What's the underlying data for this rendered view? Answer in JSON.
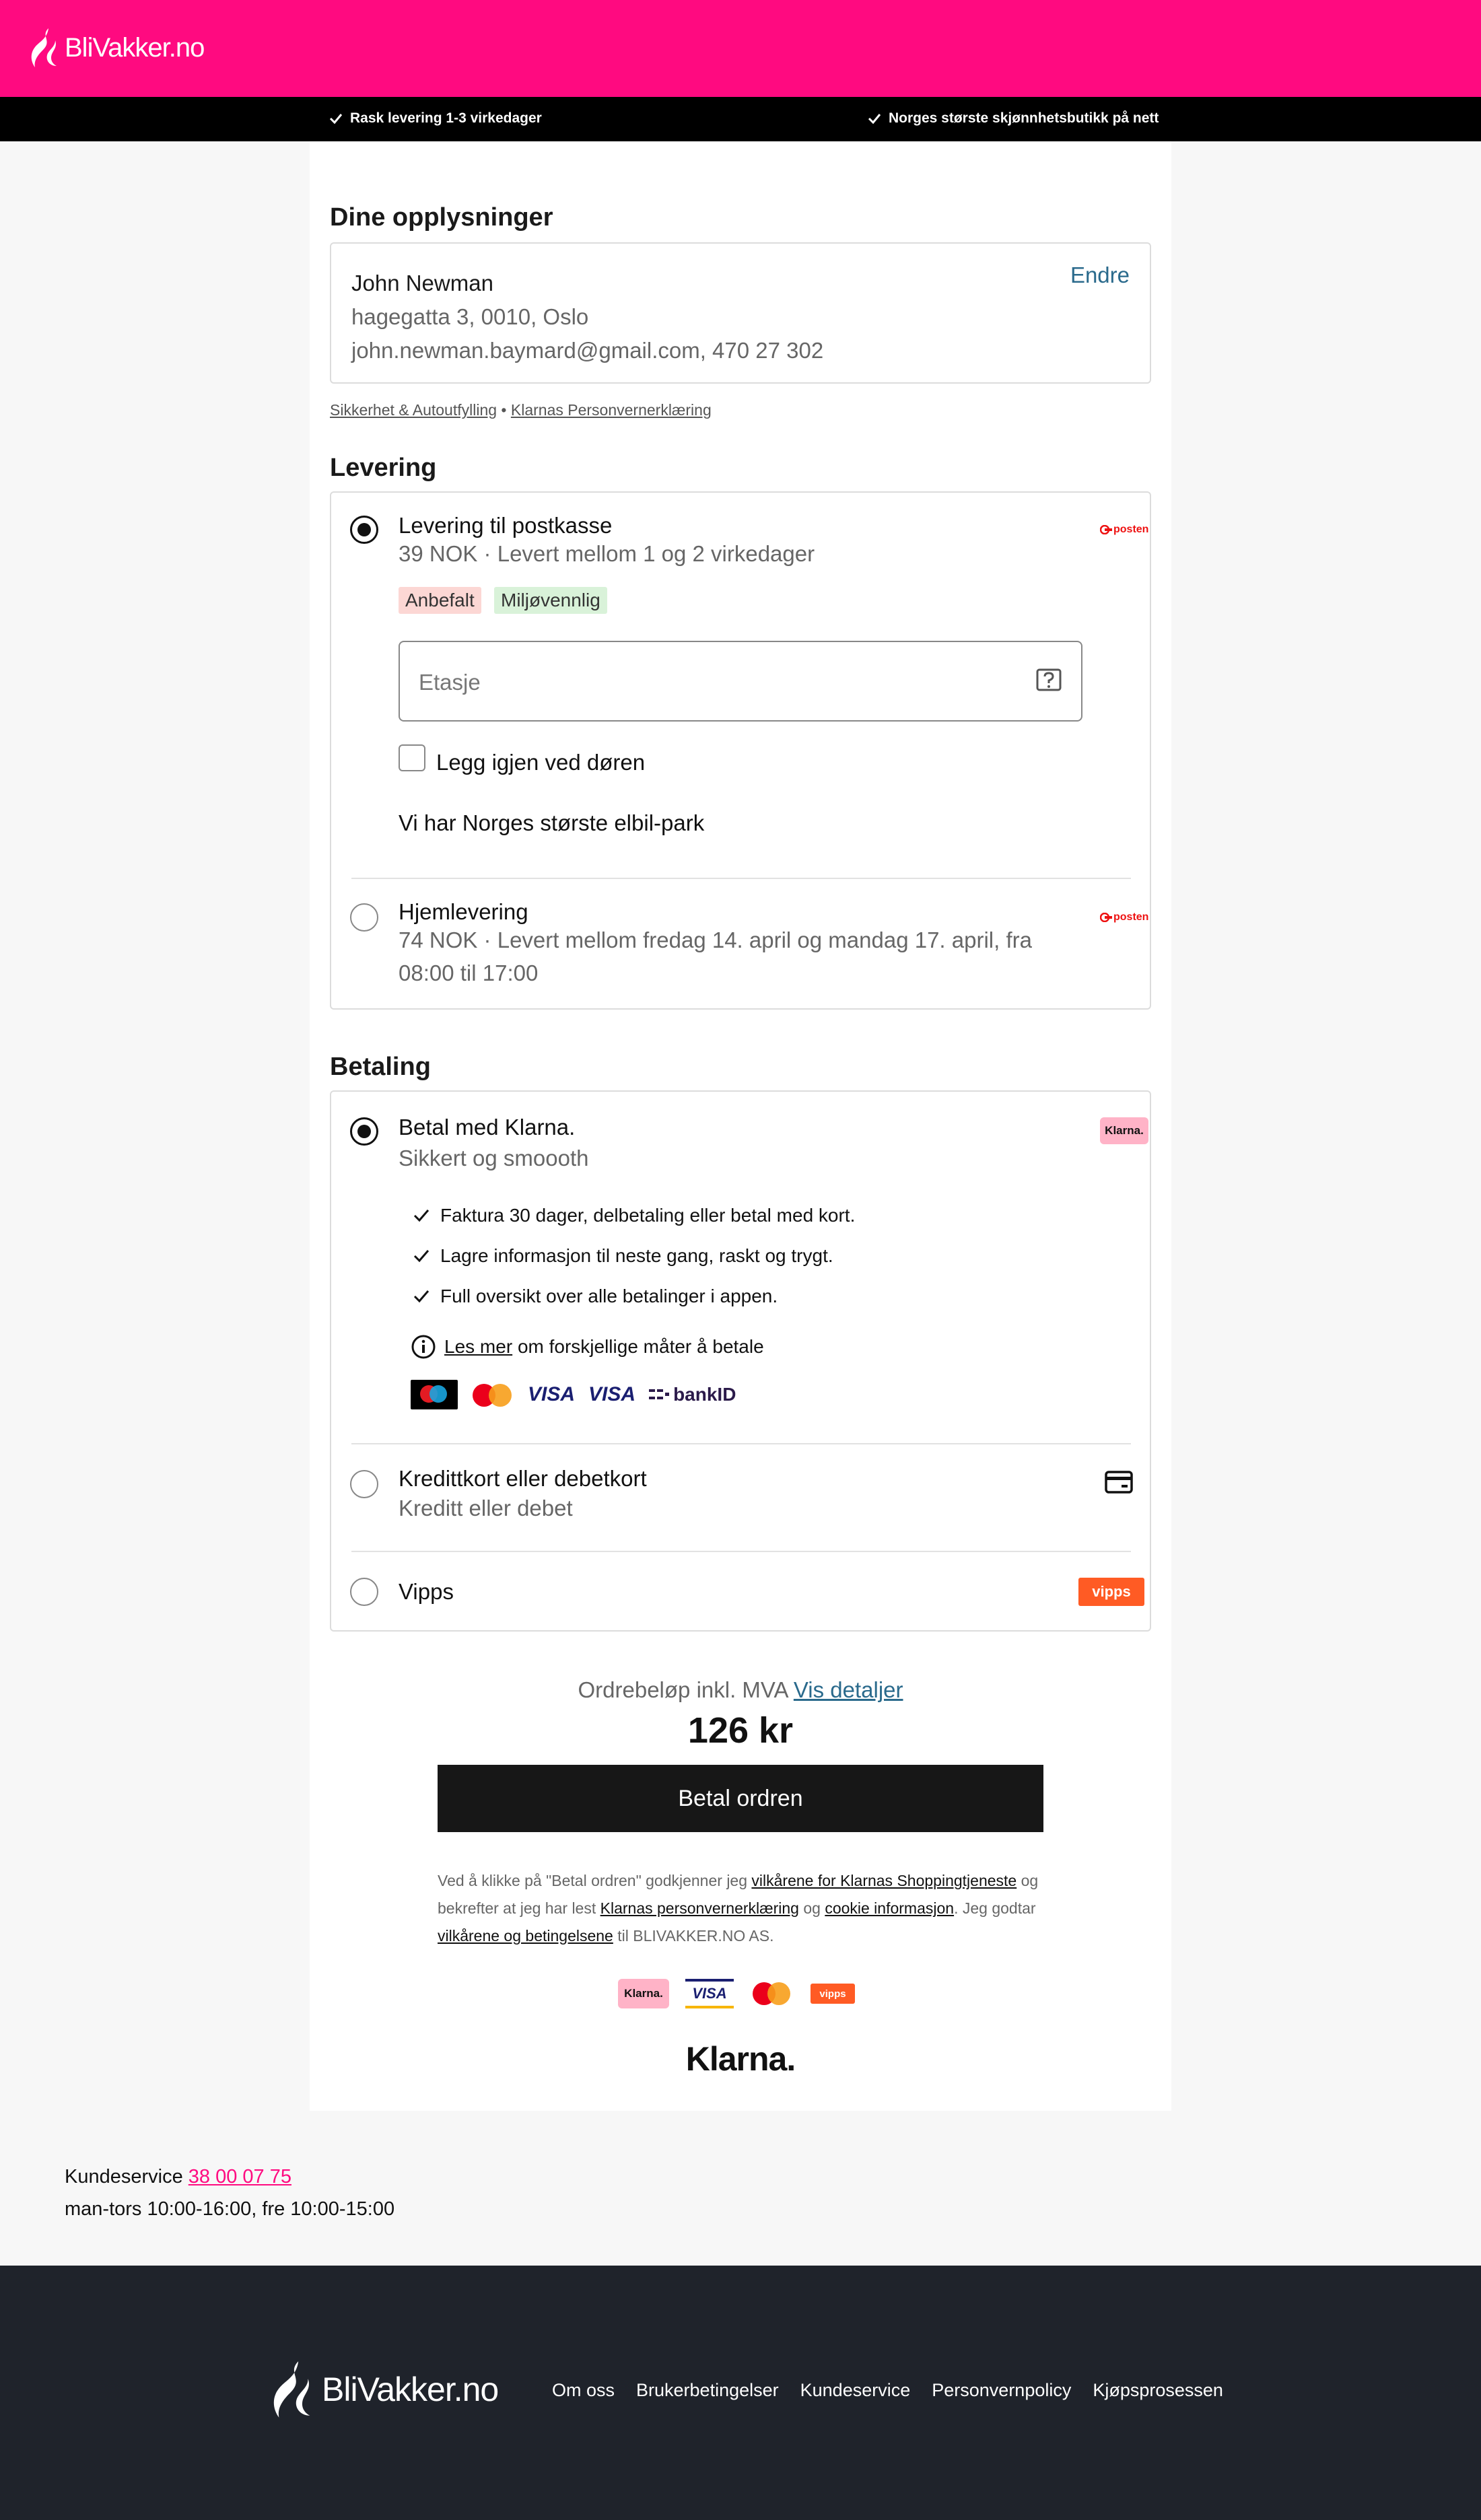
{
  "header": {
    "logo_text": "BliVakker.no",
    "usps": [
      "Rask levering 1-3 virkedager",
      "Norges største skjønnhetsbutikk på nett"
    ]
  },
  "info": {
    "title": "Dine opplysninger",
    "name": "John Newman",
    "address": "hagegatta 3, 0010, Oslo",
    "contact": "john.newman.baymard@gmail.com, 470 27 302",
    "edit_label": "Endre",
    "link_security": "Sikkerhet & Autoutfylling",
    "link_separator": "•",
    "link_privacy": "Klarnas Personvernerklæring"
  },
  "delivery": {
    "title": "Levering",
    "carrier_label": "posten",
    "options": [
      {
        "title": "Levering til postkasse",
        "subtitle": "39 NOK · Levert mellom 1 og 2 virkedager",
        "selected": true,
        "badges": [
          "Anbefalt",
          "Miljøvennlig"
        ]
      },
      {
        "title": "Hjemlevering",
        "subtitle": "74 NOK · Levert mellom fredag 14. april og mandag 17. april, fra 08:00 til 17:00",
        "selected": false
      }
    ],
    "floor_placeholder": "Etasje",
    "leave_at_door_label": "Legg igjen ved døren",
    "promo_text": "Vi har Norges største elbil-park"
  },
  "payment": {
    "title": "Betaling",
    "klarna": {
      "title": "Betal med Klarna.",
      "subtitle": "Sikkert og smoooth",
      "logo_text": "Klarna.",
      "features": [
        "Faktura 30 dager, delbetaling eller betal med kort.",
        "Lagre informasjon til neste gang, raskt og trygt.",
        "Full oversikt over alle betalinger i appen."
      ],
      "read_more_link": "Les mer",
      "read_more_rest": "om forskjellige måter å betale",
      "method_logos": [
        "maestro",
        "mastercard",
        "VISA",
        "VISA",
        "bankID"
      ]
    },
    "card": {
      "title": "Kredittkort eller debetkort",
      "subtitle": "Kreditt eller debet"
    },
    "vipps": {
      "title": "Vipps",
      "logo_text": "vipps"
    }
  },
  "summary": {
    "label": "Ordrebeløp inkl. MVA",
    "details_link": "Vis detaljer",
    "total": "126 kr",
    "pay_button": "Betal ordren"
  },
  "terms": {
    "t1": "Ved å klikke på \"Betal ordren\" godkjenner jeg ",
    "l1": "vilkårene for Klarnas Shoppingtjeneste",
    "t2": " og bekrefter at jeg har lest ",
    "l2": "Klarnas personvernerklæring",
    "t3": " og ",
    "l3": "cookie informasjon",
    "t4": ". Jeg godtar ",
    "l4": "vilkårene og betingelsene",
    "t5": " til BLIVAKKER.NO AS."
  },
  "bottom_logos": [
    "Klarna.",
    "VISA",
    "mastercard",
    "vipps"
  ],
  "klarna_wordmark": "Klarna.",
  "customer_service": {
    "label": "Kundeservice",
    "phone": "38 00 07 75",
    "hours": "man-tors 10:00-16:00, fre 10:00-15:00"
  },
  "footer": {
    "logo_text": "BliVakker.no",
    "links": [
      "Om oss",
      "Brukerbetingelser",
      "Kundeservice",
      "Personvernpolicy",
      "Kjøpsprosessen"
    ]
  },
  "colors": {
    "brand_pink": "#ff0a80",
    "footer_bg": "#1f232b",
    "link_blue": "#2a6a8c",
    "klarna_pink": "#ffb3c7",
    "vipps_orange": "#ff5b24"
  }
}
